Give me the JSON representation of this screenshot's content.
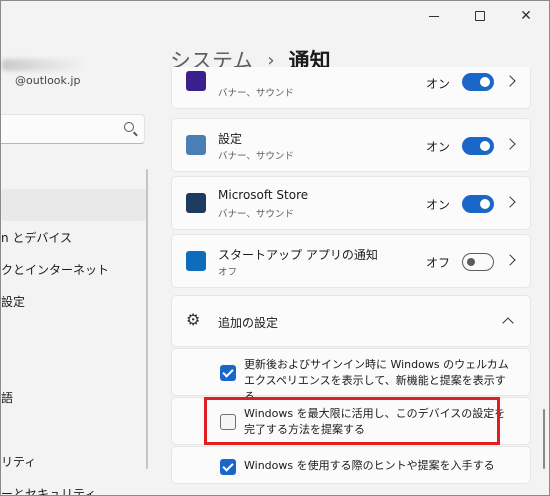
{
  "window": {
    "controls": {
      "minimize_icon": "minimize-icon",
      "maximize_icon": "maximize-icon",
      "close_label": "✕"
    }
  },
  "sidebar": {
    "account_email": "@outlook.jp",
    "search_icon": "search-icon",
    "items": [
      {
        "label": ""
      },
      {
        "label": "n とデバイス"
      },
      {
        "label": "クとインターネット"
      },
      {
        "label": "設定"
      },
      {
        "label": ""
      },
      {
        "label": ""
      },
      {
        "label": "語"
      },
      {
        "label": ""
      },
      {
        "label": "リティ"
      },
      {
        "label": "ーとセキュリティ"
      }
    ]
  },
  "header": {
    "parent": "システム",
    "separator": "›",
    "current": "通知"
  },
  "apps": [
    {
      "title": "",
      "subtitle": "バナー、サウンド",
      "toggle_label": "オン",
      "on": true,
      "icon_color": "#3b1f8c"
    },
    {
      "title": "設定",
      "subtitle": "バナー、サウンド",
      "toggle_label": "オン",
      "on": true,
      "icon_color": "#4a7fb5"
    },
    {
      "title": "Microsoft Store",
      "subtitle": "バナー、サウンド",
      "toggle_label": "オン",
      "on": true,
      "icon_color": "#1f3a5f"
    },
    {
      "title": "スタートアップ アプリの通知",
      "subtitle": "オフ",
      "toggle_label": "オフ",
      "on": false,
      "icon_color": "#0f6cbd"
    }
  ],
  "additional": {
    "title": "追加の設定",
    "options": [
      {
        "text": "更新後およびサインイン時に Windows のウェルカム エクスペリエンスを表示して、新機能と提案を表示する",
        "checked": true
      },
      {
        "text": "Windows を最大限に活用し、このデバイスの設定を完了する方法を提案する",
        "checked": false
      },
      {
        "text": "Windows を使用する際のヒントや提案を入手する",
        "checked": true
      }
    ]
  },
  "colors": {
    "accent": "#1a67c9",
    "highlight": "#e02020"
  }
}
